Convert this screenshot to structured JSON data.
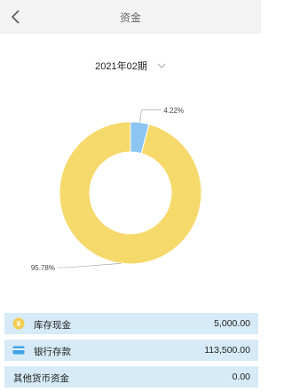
{
  "header": {
    "title": "资金",
    "back_icon": "chevron-left-icon"
  },
  "period": {
    "label": "2021年02期",
    "dropdown_icon": "chevron-down-icon"
  },
  "chart_data": {
    "type": "pie",
    "subtype": "donut",
    "slices": [
      {
        "value": 95.78,
        "label": "95.78%",
        "color": "#f6d96b"
      },
      {
        "value": 4.22,
        "label": "4.22%",
        "color": "#8cc4f2"
      }
    ]
  },
  "rows": [
    {
      "label": "库存现金",
      "value": "5,000.00",
      "icon": "coin-icon",
      "icon_color": "#f3cd52"
    },
    {
      "label": "银行存款",
      "value": "113,500.00",
      "icon": "bank-card-icon",
      "icon_color": "#3ea3e6"
    },
    {
      "label": "其他货币资金",
      "value": "0.00",
      "icon": ""
    }
  ]
}
